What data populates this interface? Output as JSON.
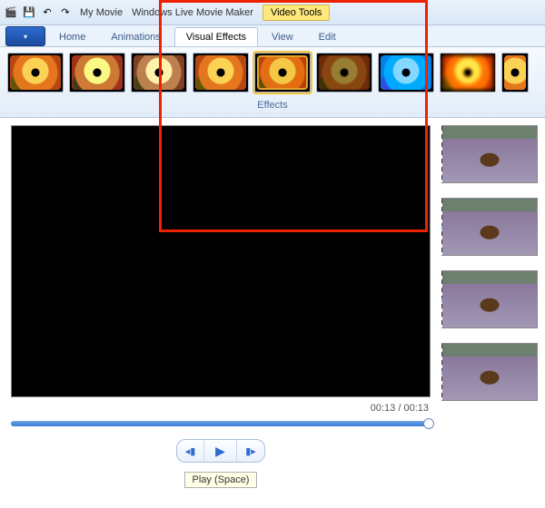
{
  "title": {
    "project": "My Movie",
    "app": "Windows Live Movie Maker",
    "contextTab": "Video Tools"
  },
  "tabs": {
    "home": "Home",
    "animations": "Animations",
    "visualEffects": "Visual Effects",
    "view": "View",
    "edit": "Edit"
  },
  "ribbon": {
    "groupLabel": "Effects"
  },
  "preview": {
    "time": "00:13 / 00:13",
    "tooltip": "Play (Space)"
  },
  "icons": {
    "prev": "◂▮",
    "play": "▶",
    "next": "▮▸",
    "appMenu": "▾",
    "save": "💾",
    "undo": "↶",
    "redo": "↷"
  }
}
